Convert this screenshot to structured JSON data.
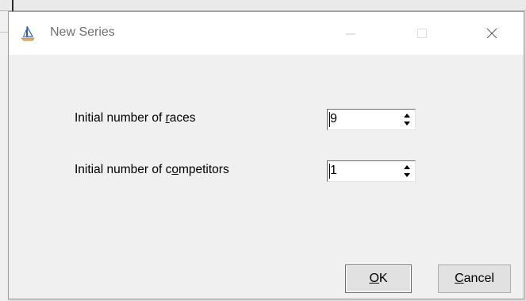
{
  "window": {
    "title": "New Series",
    "icon": "sailboat-icon",
    "controls": {
      "minimize": "minimize-icon",
      "maximize": "maximize-icon",
      "close": "close-icon"
    }
  },
  "form": {
    "races": {
      "label_before": "Initial number of ",
      "label_mnemonic": "r",
      "label_after": "aces",
      "value": "9"
    },
    "competitors": {
      "label_before": "Initial number of c",
      "label_mnemonic": "o",
      "label_after": "mpetitors",
      "value": "1"
    }
  },
  "buttons": {
    "ok": {
      "mnemonic": "O",
      "rest": "K"
    },
    "cancel": {
      "mnemonic": "C",
      "rest": "ancel"
    }
  }
}
